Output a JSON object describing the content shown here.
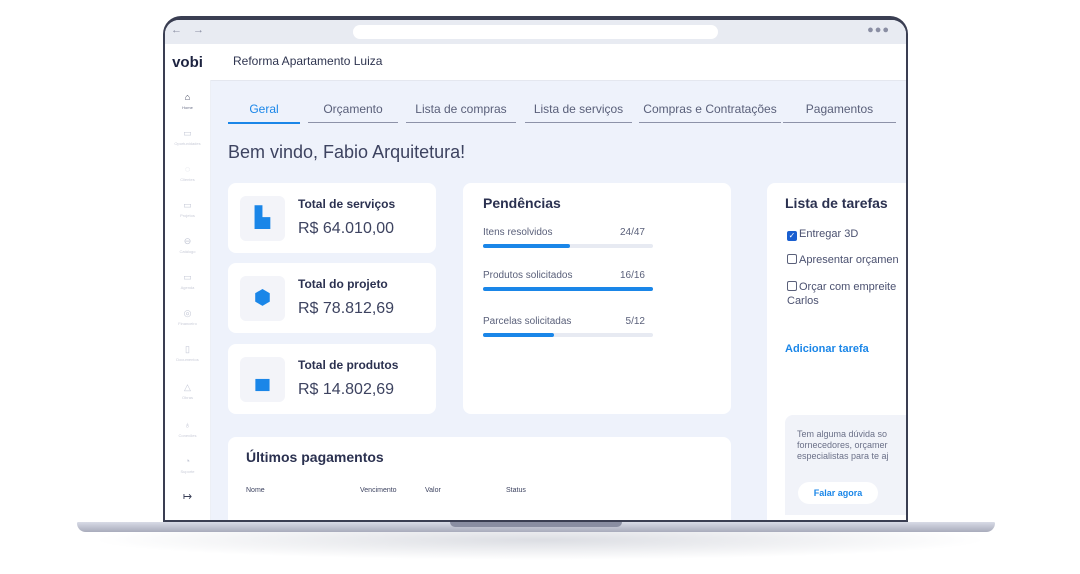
{
  "browser": {
    "nav_arrows": "← →",
    "menu_dots": "●●●"
  },
  "app": {
    "logo": "vobi",
    "project_title": "Reforma Apartamento Luiza"
  },
  "sidebar": {
    "items": [
      {
        "label": "Home",
        "icon": "home-icon",
        "glyph": "⌂"
      },
      {
        "label": "Oportunidades",
        "icon": "chat-icon",
        "glyph": "▭"
      },
      {
        "label": "Clientes",
        "icon": "user-icon",
        "glyph": "◌"
      },
      {
        "label": "Projetos",
        "icon": "folder-icon",
        "glyph": "▭"
      },
      {
        "label": "Catálogo",
        "icon": "car-icon",
        "glyph": "⊖"
      },
      {
        "label": "Agenda",
        "icon": "calendar-icon",
        "glyph": "▭"
      },
      {
        "label": "Financeiro",
        "icon": "money-icon",
        "glyph": "◎"
      },
      {
        "label": "Documentos",
        "icon": "document-icon",
        "glyph": "▯"
      },
      {
        "label": "Obras",
        "icon": "crane-icon",
        "glyph": "△"
      },
      {
        "label": "Conexões",
        "icon": "bulb-icon",
        "glyph": "♁"
      },
      {
        "label": "Suporte",
        "icon": "support-icon",
        "glyph": "◔"
      }
    ],
    "logout_glyph": "↦"
  },
  "tabs": [
    {
      "label": "Geral"
    },
    {
      "label": "Orçamento"
    },
    {
      "label": "Lista de compras"
    },
    {
      "label": "Lista de serviços"
    },
    {
      "label": "Compras e Contratações"
    },
    {
      "label": "Pagamentos"
    }
  ],
  "welcome": "Bem vindo, Fabio Arquitetura!",
  "stats": [
    {
      "title": "Total de serviços",
      "value": "R$ 64.010,00",
      "icon": "document-stack-icon",
      "glyph": "▙"
    },
    {
      "title": "Total do projeto",
      "value": "R$ 78.812,69",
      "icon": "cube-icon",
      "glyph": "⬢"
    },
    {
      "title": "Total de produtos",
      "value": "R$ 14.802,69",
      "icon": "shopping-bag-icon",
      "glyph": "▄"
    }
  ],
  "pendencias": {
    "title": "Pendências",
    "rows": [
      {
        "label": "Itens resolvidos",
        "count": "24/47",
        "progress": 0.51
      },
      {
        "label": "Produtos solicitados",
        "count": "16/16",
        "progress": 1.0
      },
      {
        "label": "Parcelas solicitadas",
        "count": "5/12",
        "progress": 0.42
      }
    ]
  },
  "tarefas": {
    "title": "Lista de tarefas",
    "items": [
      {
        "label": "Entregar 3D",
        "checked": true,
        "check_glyph": "✓"
      },
      {
        "label": "Apresentar orçamen",
        "checked": false,
        "check_glyph": ""
      },
      {
        "label": "Orçar com empreite Carlos",
        "checked": false,
        "check_glyph": ""
      }
    ],
    "add_label": "Adicionar tarefa"
  },
  "help": {
    "lines": [
      "Tem alguma dúvida so",
      "fornecedores, orçamer",
      "especialistas para te aj"
    ],
    "button": "Falar agora"
  },
  "pagamentos": {
    "title": "Últimos pagamentos",
    "columns": [
      "Nome",
      "Vencimento",
      "Valor",
      "Status"
    ]
  },
  "colors": {
    "accent": "#1a86e8",
    "background": "#eef2fb",
    "frame": "#3a3e52"
  }
}
